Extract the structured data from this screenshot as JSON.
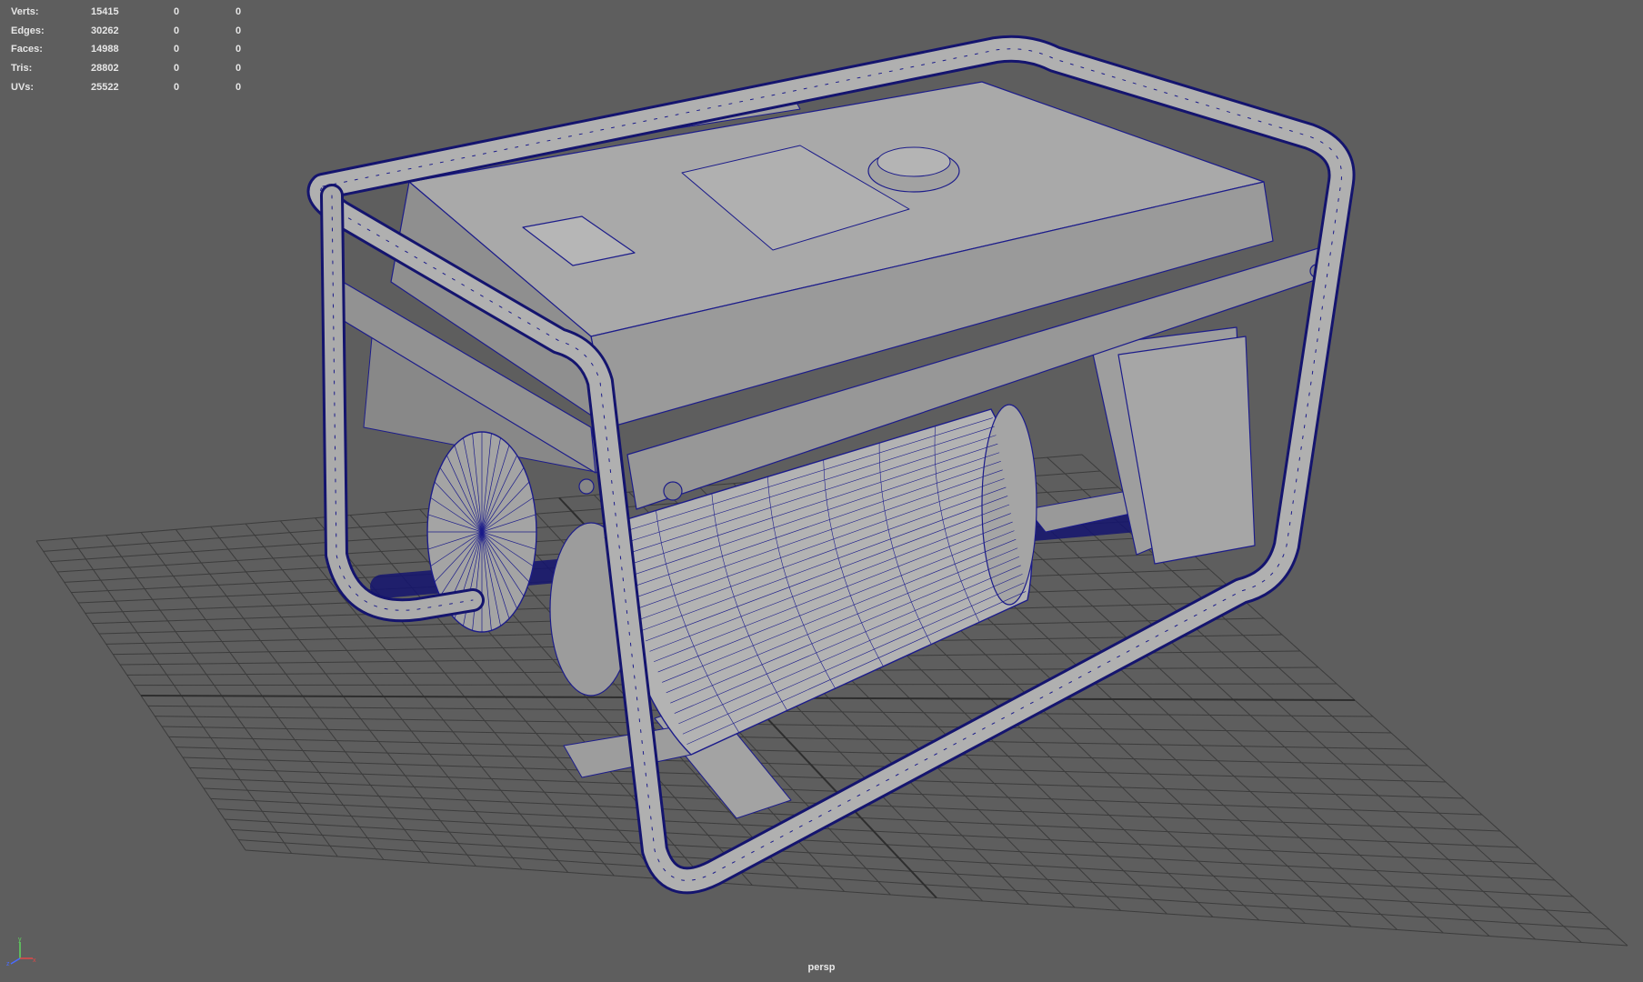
{
  "viewport": {
    "camera": "persp",
    "background": "#5e5e5e",
    "grid_color": "#3a3a3a",
    "wire_color": "#1c1c8a",
    "model_shade": "#a8a8a8"
  },
  "hud": {
    "rows": [
      {
        "label": "Verts:",
        "v1": "15415",
        "v2": "0",
        "v3": "0"
      },
      {
        "label": "Edges:",
        "v1": "30262",
        "v2": "0",
        "v3": "0"
      },
      {
        "label": "Faces:",
        "v1": "14988",
        "v2": "0",
        "v3": "0"
      },
      {
        "label": "Tris:",
        "v1": "28802",
        "v2": "0",
        "v3": "0"
      },
      {
        "label": "UVs:",
        "v1": "25522",
        "v2": "0",
        "v3": "0"
      }
    ]
  },
  "axis_gizmo": {
    "x": "x",
    "y": "y",
    "z": "z"
  },
  "icons": [
    "axis-gizmo-icon"
  ]
}
